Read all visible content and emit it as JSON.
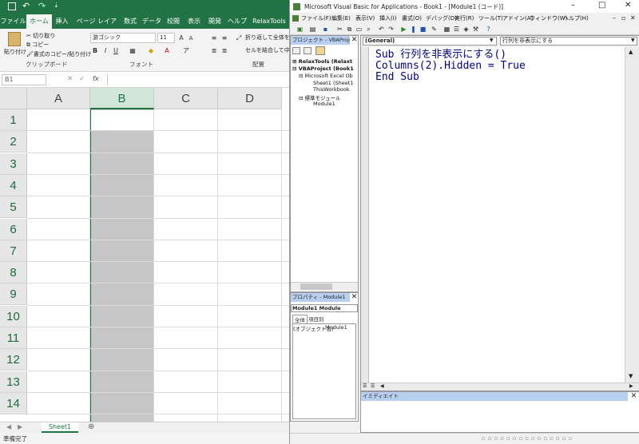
{
  "excel": {
    "ribbon_tabs": [
      "ファイル",
      "ホーム",
      "挿入",
      "ページ レイアウト",
      "数式",
      "データ",
      "校閲",
      "表示",
      "開発",
      "ヘルプ",
      "RelaxTools"
    ],
    "ribbon": {
      "paste": "貼り付け",
      "cut": "切り取り",
      "copy": "コピー",
      "format_painter": "書式のコピー/貼り付け",
      "clipboard_group": "クリップボード",
      "font_name": "游ゴシック",
      "font_size": "11",
      "font_group": "フォント",
      "wrap_text": "折り返して全体を表示する",
      "merge": "セルを結合して中央揃え",
      "alignment_group": "配置"
    },
    "name_box": "B1",
    "fx": "fx",
    "columns": [
      "A",
      "B",
      "C",
      "D"
    ],
    "rows": [
      "1",
      "2",
      "3",
      "4",
      "5",
      "6",
      "7",
      "8",
      "9",
      "10",
      "11",
      "12",
      "13",
      "14"
    ],
    "sheet_tab": "Sheet1",
    "add_sheet": "⊕",
    "status": "準備完了"
  },
  "vbe": {
    "title": "Microsoft Visual Basic for Applications - Book1 - [Module1 (コード)]",
    "menu": [
      "ファイル(F)",
      "編集(E)",
      "表示(V)",
      "挿入(I)",
      "書式(O)",
      "デバッグ(D)",
      "実行(R)",
      "ツール(T)",
      "アドイン(A)",
      "ウィンドウ(W)",
      "ヘルプ(H)"
    ],
    "project_title": "プロジェクト - VBAProject",
    "tree": [
      "RelaxTools (Relaxt",
      "VBAProject (Book1",
      "Microsoft Excel Ob",
      "Sheet1 (Sheet1",
      "ThisWorkbook",
      "標準モジュール",
      "Module1"
    ],
    "props_title": "プロパティ - Module1",
    "props_object": "Module1 Module",
    "props_tab_all": "全体",
    "props_tab_cat": "項目別",
    "props_name_key": "(オブジェクト名)",
    "props_name_val": "Module1",
    "combo_left": "(General)",
    "combo_right": "行列を非表示にする",
    "code": [
      "Sub 行列を非表示にする()",
      "Columns(2).Hidden = True",
      "End Sub"
    ],
    "immediate_title": "イミディエイト"
  }
}
